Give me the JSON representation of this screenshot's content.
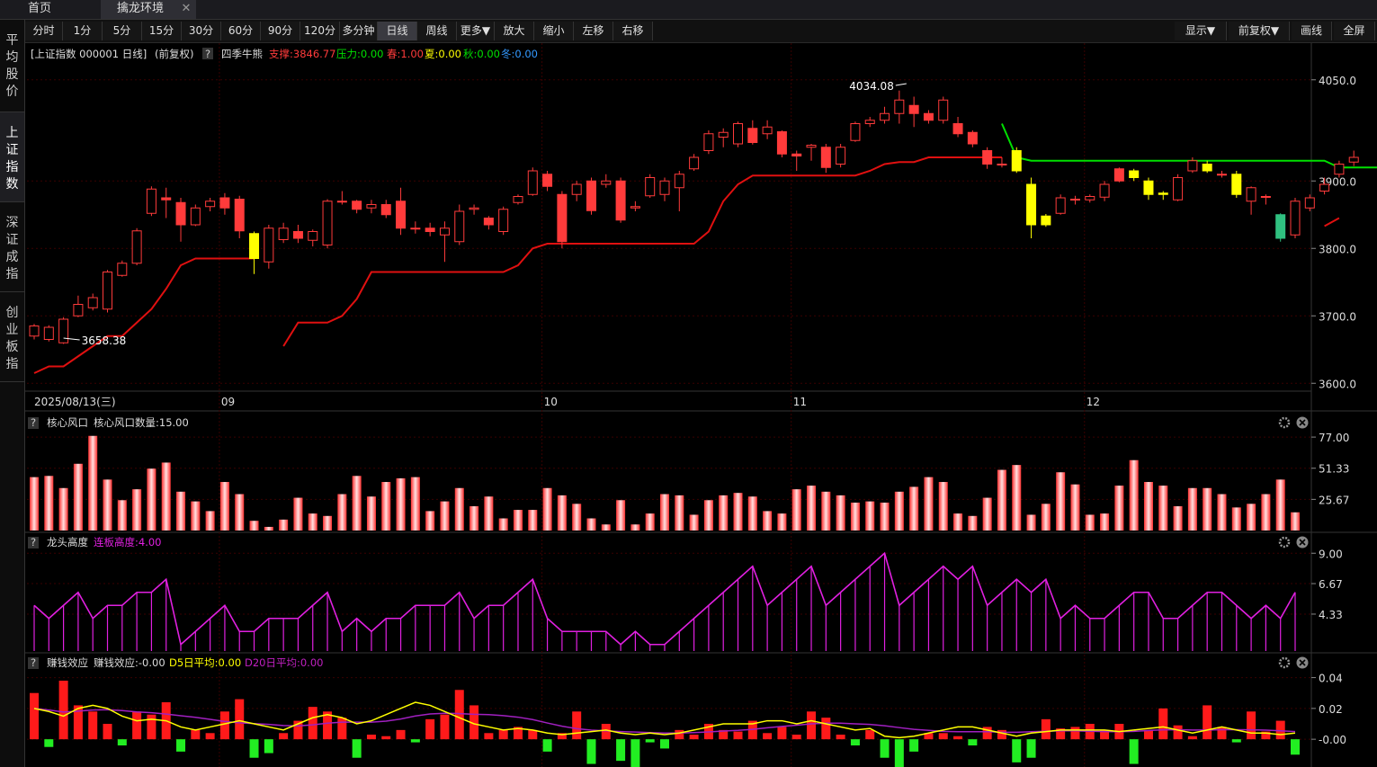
{
  "tabs": {
    "home": "首页",
    "env": "擒龙环境",
    "close": "✕"
  },
  "toolbar": {
    "buttons": [
      "分时",
      "1分",
      "5分",
      "15分",
      "30分",
      "60分",
      "90分",
      "120分",
      "多分钟",
      "日线",
      "周线",
      "更多▼",
      "放大",
      "缩小",
      "左移",
      "右移"
    ],
    "active": "日线",
    "right_buttons": [
      "显示▼",
      "前复权▼",
      "画线",
      "全屏"
    ]
  },
  "leftnav": [
    "平均股价",
    "上证指数",
    "深证成指",
    "创业板指"
  ],
  "leftnav_active": "上证指数",
  "colors": {
    "up": "#ff3b3b",
    "down_cyan": "#00d4d4",
    "yellow": "#ffff00",
    "green_line": "#00e000",
    "red_line": "#e01010",
    "magenta": "#e020e0",
    "green_bar": "#00ee00",
    "grid": "#3a0000",
    "axis": "#c0c0c0"
  },
  "chart_data": [
    {
      "type": "candlestick",
      "header": {
        "symbol": "[上证指数 000001 日线]",
        "adjust": "(前复权)",
        "help": "?",
        "indicator": "四季牛熊",
        "support": "支撑:3846.77",
        "pressure": "压力:0.00",
        "spring": "春:1.00",
        "summer": "夏:0.00",
        "autumn": "秋:0.00",
        "winter": "冬:0.00"
      },
      "ylim": [
        3595,
        4075
      ],
      "yticks": [
        "3600.0",
        "3700.0",
        "3800.0",
        "3900.0",
        "4050.0"
      ],
      "ytick_values": [
        3600,
        3700,
        3800,
        3900,
        4050
      ],
      "date_label": "2025/08/13(三)",
      "month_labels": [
        {
          "label": "09",
          "index": 13
        },
        {
          "label": "10",
          "index": 35
        },
        {
          "label": "11",
          "index": 52
        },
        {
          "label": "12",
          "index": 72
        }
      ],
      "annotation_high": {
        "text": "4034.08",
        "index": 59,
        "value": 4034.08
      },
      "annotation_low": {
        "text": "3658.38",
        "index": 2,
        "value": 3658.38
      },
      "candles": [
        [
          3670,
          3685,
          3665,
          3688,
          "up"
        ],
        [
          3665,
          3683,
          3662,
          3686,
          "up"
        ],
        [
          3660,
          3695,
          3658.38,
          3698,
          "up"
        ],
        [
          3700,
          3717,
          3698,
          3730,
          "up"
        ],
        [
          3712,
          3727,
          3708,
          3733,
          "up"
        ],
        [
          3710,
          3765,
          3705,
          3768,
          "up"
        ],
        [
          3760,
          3778,
          3758,
          3782,
          "up"
        ],
        [
          3778,
          3826,
          3775,
          3830,
          "up"
        ],
        [
          3852,
          3888,
          3848,
          3892,
          "up"
        ],
        [
          3875,
          3872,
          3845,
          3890,
          "up"
        ],
        [
          3868,
          3835,
          3810,
          3875,
          "up"
        ],
        [
          3835,
          3860,
          3833,
          3865,
          "up"
        ],
        [
          3862,
          3870,
          3855,
          3875,
          "up"
        ],
        [
          3875,
          3860,
          3850,
          3882,
          "up"
        ],
        [
          3873,
          3826,
          3815,
          3878,
          "down"
        ],
        [
          3822,
          3785,
          3762,
          3825,
          "yellow"
        ],
        [
          3780,
          3830,
          3770,
          3835,
          "up"
        ],
        [
          3813,
          3830,
          3808,
          3838,
          "up"
        ],
        [
          3825,
          3815,
          3808,
          3835,
          "up"
        ],
        [
          3812,
          3825,
          3803,
          3828,
          "up"
        ],
        [
          3805,
          3870,
          3800,
          3873,
          "up"
        ],
        [
          3870,
          3870,
          3865,
          3885,
          "up"
        ],
        [
          3870,
          3858,
          3852,
          3872,
          "up"
        ],
        [
          3860,
          3865,
          3852,
          3872,
          "up"
        ],
        [
          3865,
          3850,
          3845,
          3872,
          "up"
        ],
        [
          3870,
          3830,
          3820,
          3890,
          "up"
        ],
        [
          3830,
          3830,
          3822,
          3840,
          "up"
        ],
        [
          3830,
          3825,
          3818,
          3838,
          "up"
        ],
        [
          3820,
          3830,
          3780,
          3840,
          "up"
        ],
        [
          3810,
          3855,
          3805,
          3865,
          "up"
        ],
        [
          3858,
          3860,
          3850,
          3865,
          "up"
        ],
        [
          3845,
          3835,
          3828,
          3848,
          "up"
        ],
        [
          3825,
          3858,
          3820,
          3862,
          "up"
        ],
        [
          3868,
          3877,
          3865,
          3880,
          "up"
        ],
        [
          3880,
          3915,
          3878,
          3920,
          "up"
        ],
        [
          3910,
          3892,
          3885,
          3915,
          "up"
        ],
        [
          3880,
          3810,
          3800,
          3885,
          "up"
        ],
        [
          3880,
          3895,
          3870,
          3900,
          "up"
        ],
        [
          3900,
          3856,
          3850,
          3905,
          "up"
        ],
        [
          3895,
          3900,
          3890,
          3910,
          "up"
        ],
        [
          3900,
          3842,
          3838,
          3905,
          "up"
        ],
        [
          3860,
          3862,
          3855,
          3870,
          "up"
        ],
        [
          3878,
          3905,
          3875,
          3910,
          "up"
        ],
        [
          3880,
          3900,
          3870,
          3905,
          "up"
        ],
        [
          3890,
          3910,
          3855,
          3915,
          "up"
        ],
        [
          3918,
          3935,
          3915,
          3940,
          "up"
        ],
        [
          3945,
          3970,
          3940,
          3975,
          "up"
        ],
        [
          3965,
          3972,
          3950,
          3978,
          "up"
        ],
        [
          3955,
          3985,
          3950,
          3988,
          "up"
        ],
        [
          3978,
          3957,
          3954,
          3990,
          "up"
        ],
        [
          3970,
          3980,
          3962,
          3990,
          "up"
        ],
        [
          3973,
          3940,
          3935,
          3975,
          "up"
        ],
        [
          3940,
          3937,
          3915,
          3945,
          "up"
        ],
        [
          3950,
          3953,
          3930,
          3955,
          "up"
        ],
        [
          3950,
          3920,
          3912,
          3955,
          "up"
        ],
        [
          3925,
          3950,
          3920,
          3955,
          "up"
        ],
        [
          3960,
          3985,
          3958,
          3988,
          "up"
        ],
        [
          3985,
          3990,
          3980,
          3995,
          "up"
        ],
        [
          3990,
          4000,
          3985,
          4010,
          "up"
        ],
        [
          4000,
          4020,
          3985,
          4034.08,
          "up"
        ],
        [
          4012,
          4000,
          3980,
          4025,
          "up"
        ],
        [
          4000,
          3990,
          3985,
          4005,
          "up"
        ],
        [
          3990,
          4020,
          3985,
          4025,
          "up"
        ],
        [
          3985,
          3970,
          3965,
          3995,
          "up"
        ],
        [
          3972,
          3955,
          3950,
          3975,
          "up"
        ],
        [
          3945,
          3925,
          3918,
          3950,
          "up"
        ],
        [
          3925,
          3925,
          3920,
          3935,
          "up"
        ],
        [
          3945,
          3915,
          3912,
          3950,
          "yellow"
        ],
        [
          3895,
          3835,
          3815,
          3905,
          "yellow"
        ],
        [
          3848,
          3835,
          3832,
          3851,
          "yellow"
        ],
        [
          3852,
          3875,
          3850,
          3880,
          "up"
        ],
        [
          3872,
          3873,
          3865,
          3878,
          "up"
        ],
        [
          3872,
          3877,
          3868,
          3880,
          "up"
        ],
        [
          3876,
          3895,
          3870,
          3900,
          "up"
        ],
        [
          3918,
          3900,
          3898,
          3920,
          "up"
        ],
        [
          3915,
          3905,
          3900,
          3918,
          "yellow"
        ],
        [
          3900,
          3880,
          3872,
          3905,
          "yellow"
        ],
        [
          3880,
          3882,
          3872,
          3885,
          "yellow"
        ],
        [
          3872,
          3905,
          3870,
          3910,
          "up"
        ],
        [
          3915,
          3930,
          3912,
          3935,
          "up"
        ],
        [
          3925,
          3915,
          3912,
          3930,
          "yellow"
        ],
        [
          3910,
          3910,
          3905,
          3915,
          "up"
        ],
        [
          3910,
          3880,
          3875,
          3915,
          "yellow"
        ],
        [
          3870,
          3890,
          3850,
          3892,
          "up"
        ],
        [
          3876,
          3877,
          3865,
          3880,
          "up"
        ],
        [
          3850,
          3815,
          3810,
          3852,
          "down_green"
        ],
        [
          3820,
          3870,
          3815,
          3875,
          "up"
        ],
        [
          3860,
          3875,
          3855,
          3880,
          "up"
        ],
        [
          3885,
          3895,
          3880,
          3905,
          "up"
        ],
        [
          3910,
          3925,
          3905,
          3930,
          "up"
        ],
        [
          3928,
          3935,
          3922,
          3945,
          "up"
        ]
      ],
      "support_line": [
        3615,
        3625,
        3625,
        3640,
        3655,
        3670,
        3670,
        3690,
        3710,
        3740,
        3775,
        3785,
        3785,
        3785,
        3785,
        3785,
        null,
        3655,
        3690,
        3690,
        3690,
        3700,
        3725,
        3765,
        3765,
        3765,
        3765,
        3765,
        3765,
        3765,
        3765,
        3765,
        3765,
        3775,
        3800,
        3807,
        3807,
        3807,
        3807,
        3807,
        3807,
        3807,
        3807,
        3807,
        3807,
        3807,
        3825,
        3870,
        3895,
        3908,
        3908,
        3908,
        3908,
        3908,
        3908,
        3908,
        3908,
        3915,
        3925,
        3928,
        3928,
        3935,
        3935,
        3935,
        3935,
        3935,
        3935,
        null,
        null,
        null,
        null,
        null,
        null,
        null,
        null,
        null,
        null,
        null,
        null,
        null,
        null,
        null,
        null,
        null,
        null,
        null,
        null,
        null,
        3833,
        3845
      ],
      "pressure_line": {
        "start_index": 66,
        "values": [
          3985,
          3935,
          3930,
          3930,
          3930,
          3930,
          3930,
          3930,
          3930,
          3930,
          3930,
          3930,
          3930,
          3930,
          3930,
          3930,
          3930,
          3930,
          3930,
          3930,
          3930,
          3930,
          3930,
          3920,
          3920,
          3920,
          3920,
          3920
        ]
      }
    },
    {
      "type": "bar",
      "header": {
        "name": "核心风口",
        "label": "核心风口数量:15.00"
      },
      "ylim": [
        0,
        83
      ],
      "yticks": [
        "77.00",
        "51.33",
        "25.67"
      ],
      "ytick_values": [
        77,
        51.33,
        25.67
      ],
      "values": [
        44,
        45,
        35,
        55,
        78,
        42,
        25,
        34,
        51,
        56,
        32,
        24,
        16,
        40,
        30,
        8,
        3,
        9,
        27,
        14,
        12,
        30,
        45,
        28,
        40,
        43,
        44,
        16,
        24,
        35,
        20,
        28,
        10,
        17,
        17,
        35,
        29,
        22,
        10,
        5,
        25,
        5,
        14,
        30,
        29,
        13,
        25,
        29,
        31,
        28,
        16,
        14,
        34,
        37,
        32,
        29,
        23,
        24,
        23,
        32,
        36,
        44,
        40,
        14,
        12,
        27,
        50,
        54,
        13,
        22,
        48,
        38,
        13,
        14,
        37,
        58,
        40,
        37,
        20,
        35,
        35,
        30,
        19,
        22,
        30,
        42,
        15
      ]
    },
    {
      "type": "line",
      "header": {
        "name": "龙头高度",
        "label": "连板高度:4.00"
      },
      "ylim": [
        1.5,
        9.5
      ],
      "yticks": [
        "9.00",
        "6.67",
        "4.33"
      ],
      "ytick_values": [
        9,
        6.67,
        4.33
      ],
      "values": [
        5,
        4,
        5,
        6,
        4,
        5,
        5,
        6,
        6,
        7,
        2,
        3,
        4,
        5,
        3,
        3,
        4,
        4,
        4,
        5,
        6,
        3,
        4,
        3,
        4,
        4,
        5,
        5,
        5,
        6,
        4,
        5,
        5,
        6,
        7,
        4,
        3,
        3,
        3,
        3,
        2,
        3,
        2,
        2,
        3,
        4,
        5,
        6,
        7,
        8,
        5,
        6,
        7,
        8,
        5,
        6,
        7,
        8,
        9,
        5,
        6,
        7,
        8,
        7,
        8,
        5,
        6,
        7,
        6,
        7,
        4,
        5,
        4,
        4,
        5,
        6,
        6,
        4,
        4,
        5,
        6,
        6,
        5,
        4,
        5,
        4,
        6,
        3,
        4,
        4
      ]
    },
    {
      "type": "bar",
      "header": {
        "name": "赚钱效应",
        "label": "赚钱效应:-0.00",
        "d5": "D5日平均:0.00",
        "d20": "D20日平均:0.00"
      },
      "ylim": [
        -0.018,
        0.045
      ],
      "yticks": [
        "0.04",
        "0.02",
        "-0.00"
      ],
      "ytick_values": [
        0.04,
        0.02,
        0
      ],
      "values": [
        0.03,
        -0.005,
        0.038,
        0.022,
        0.018,
        0.01,
        -0.004,
        0.018,
        0.016,
        0.024,
        -0.008,
        0.006,
        0.004,
        0.018,
        0.026,
        -0.012,
        -0.009,
        0.004,
        0.012,
        0.021,
        0.018,
        0.014,
        -0.012,
        0.003,
        0.002,
        0.006,
        -0.002,
        0.013,
        0.016,
        0.032,
        0.022,
        0.004,
        0.006,
        0.008,
        0.006,
        -0.008,
        0.004,
        0.018,
        -0.016,
        0.01,
        -0.014,
        -0.022,
        -0.002,
        -0.006,
        0.006,
        0.003,
        0.01,
        0.006,
        0.005,
        0.012,
        0.004,
        0.008,
        0.003,
        0.018,
        0.014,
        0.003,
        -0.004,
        0.006,
        -0.012,
        -0.028,
        -0.008,
        0.004,
        0.004,
        0.002,
        -0.004,
        0.008,
        0.006,
        -0.015,
        -0.012,
        0.013,
        0.007,
        0.008,
        0.01,
        0.006,
        0.01,
        -0.016,
        0.006,
        0.02,
        0.009,
        0.002,
        0.022,
        0.008,
        -0.002,
        0.018,
        0.005,
        0.012,
        -0.01,
        -0.014,
        0.005,
        0.008
      ],
      "d5": [
        0.02,
        0.018,
        0.015,
        0.02,
        0.022,
        0.02,
        0.015,
        0.012,
        0.013,
        0.012,
        0.008,
        0.006,
        0.008,
        0.01,
        0.012,
        0.01,
        0.008,
        0.006,
        0.01,
        0.014,
        0.016,
        0.014,
        0.01,
        0.012,
        0.016,
        0.02,
        0.024,
        0.022,
        0.018,
        0.014,
        0.01,
        0.008,
        0.006,
        0.007,
        0.006,
        0.004,
        0.003,
        0.004,
        0.005,
        0.006,
        0.004,
        0.003,
        0.004,
        0.003,
        0.004,
        0.006,
        0.008,
        0.01,
        0.01,
        0.01,
        0.012,
        0.012,
        0.01,
        0.012,
        0.01,
        0.008,
        0.006,
        0.007,
        0.002,
        0.001,
        0.002,
        0.004,
        0.006,
        0.008,
        0.008,
        0.006,
        0.004,
        0.002,
        0.004,
        0.005,
        0.006,
        0.006,
        0.006,
        0.006,
        0.005,
        0.006,
        0.007,
        0.008,
        0.006,
        0.004,
        0.006,
        0.008,
        0.006,
        0.004,
        0.004,
        0.003,
        0.004,
        0.006,
        0.006
      ]
    }
  ]
}
